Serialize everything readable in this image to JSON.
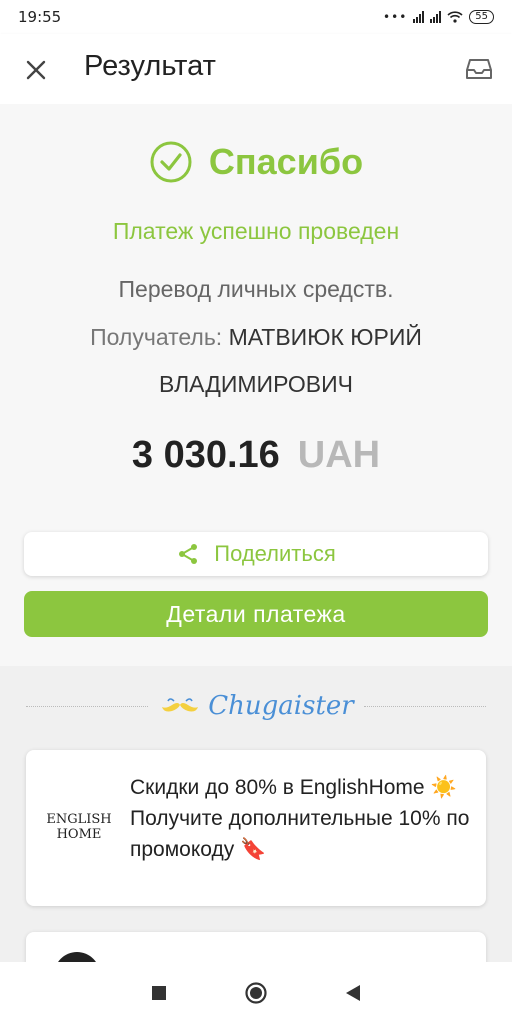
{
  "status_bar": {
    "time": "19:55",
    "battery": "55"
  },
  "header": {
    "title": "Результат",
    "close_icon": "close-icon",
    "inbox_icon": "inbox-icon"
  },
  "result": {
    "thanks": "Спасибо",
    "success_message": "Платеж успешно проведен",
    "purpose": "Перевод личных средств.",
    "recipient_label": "Получатель:",
    "recipient_name": "МАТВИЮК ЮРИЙ ВЛАДИМИРОВИЧ",
    "amount": "3 030.16",
    "currency": "UAH"
  },
  "actions": {
    "share_label": "Поделиться",
    "details_label": "Детали платежа"
  },
  "promo": {
    "brand": "Chugaister",
    "offers": [
      {
        "logo_text": "ENGLISH HOME",
        "text": "Скидки до 80% в EnglishHome ☀️ Получите дополнительные 10% по промокоду 🔖"
      }
    ]
  },
  "colors": {
    "accent": "#8cc63f",
    "brand": "#4a8fd6"
  }
}
